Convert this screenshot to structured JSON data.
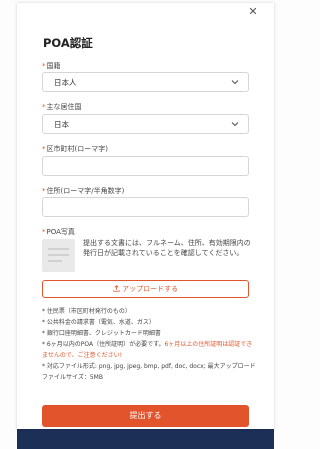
{
  "modal": {
    "close_icon": "close-icon",
    "title": "POA認証",
    "country_label": "国籍",
    "country_value": "日本人",
    "residence_label": "主な居住国",
    "residence_value": "日本",
    "city_label": "区市町村(ローマ字)",
    "city_placeholder": "",
    "address_label": "住所(ローマ字/半角数字)",
    "address_placeholder": "",
    "photo_label": "POA写真",
    "photo_description": "提出する文書には、フルネーム、住所、有効期限内の発行日が記載されていることを確認してください。",
    "upload_label": "アップロードする",
    "upload_icon": "upload-icon",
    "notes": {
      "n1": "* 住民票（市区町村発行のもの）",
      "n2": "* 公共料金の請求書（電気、水道、ガス）",
      "n3": "* 銀行口座明細書、クレジットカード明細書",
      "n4_pre": "* 6ヶ月以内のPOA（住所証明）が必要です。",
      "n4_hl": "6ヶ月以上の住所証明は認証できませんので、ご注意ください!",
      "n5": "* 対応ファイル形式: png, jpg, jpeg, bmp, pdf, doc, docx; 最大アップロードファイルサイズ：5MB"
    },
    "submit_label": "提出する"
  },
  "colors": {
    "accent": "#e2552c",
    "footer": "#1c2f57"
  }
}
